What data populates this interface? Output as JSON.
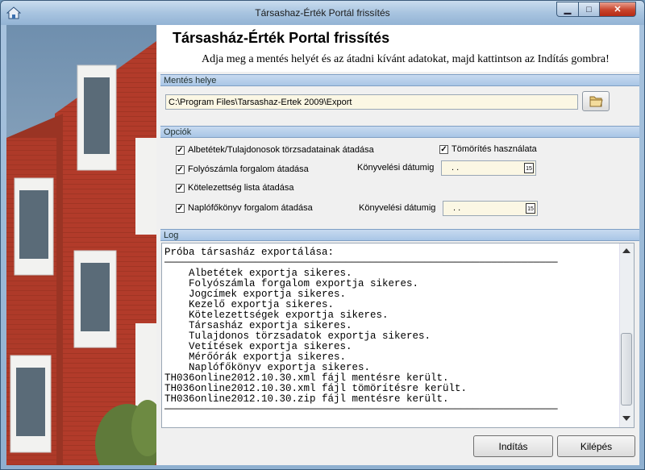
{
  "window": {
    "title": "Társashaz-Érték Portál frissítés"
  },
  "header": {
    "title": "Társasház-Érték Portal frissítés",
    "subtitle": "Adja meg a mentés helyét és az átadni kívánt adatokat, majd kattintson az Indítás gombra!"
  },
  "save": {
    "section_label": "Mentés helye",
    "path": "C:\\Program Files\\Tarsashaz-Ertek 2009\\Export"
  },
  "options": {
    "section_label": "Opciók",
    "items": [
      {
        "label": "Albetétek/Tulajdonosok törzsadatainak átadása",
        "checked": true
      },
      {
        "label": "Folyószámla forgalom átadása",
        "checked": true
      },
      {
        "label": "Kötelezettség lista átadása",
        "checked": true
      },
      {
        "label": "Naplófőkönyv forgalom átadása",
        "checked": true
      }
    ],
    "compress": {
      "label": "Tömörítés használata",
      "checked": true
    },
    "date_label_1": "Könyvelési dátumig",
    "date_value_1": " .  .",
    "date_label_2": "Könyvelési dátumig",
    "date_value_2": " .  .",
    "calendar_icon_text": "15"
  },
  "log": {
    "section_label": "Log",
    "lines": [
      "Próba társasház exportálása:",
      "─────────────────────────────────────────────────────────────────",
      "    Albetétek exportja sikeres.",
      "    Folyószámla forgalom exportja sikeres.",
      "    Jogcímek exportja sikeres.",
      "    Kezelő exportja sikeres.",
      "    Kötelezettségek exportja sikeres.",
      "    Társasház exportja sikeres.",
      "    Tulajdonos törzsadatok exportja sikeres.",
      "    Vetítések exportja sikeres.",
      "    Mérőórák exportja sikeres.",
      "    Naplófőkönyv exportja sikeres.",
      "TH036online2012.10.30.xml fájl mentésre került.",
      "TH036online2012.10.30.xml fájl tömörítésre került.",
      "TH036online2012.10.30.zip fájl mentésre került.",
      "─────────────────────────────────────────────────────────────────"
    ]
  },
  "buttons": {
    "start": "Indítás",
    "exit": "Kilépés"
  },
  "colors": {
    "brick": "#b23b2a",
    "window_frame": "#93b3d4",
    "section_bar": "#b8d0ea",
    "input_bg": "#fbf7e4"
  }
}
